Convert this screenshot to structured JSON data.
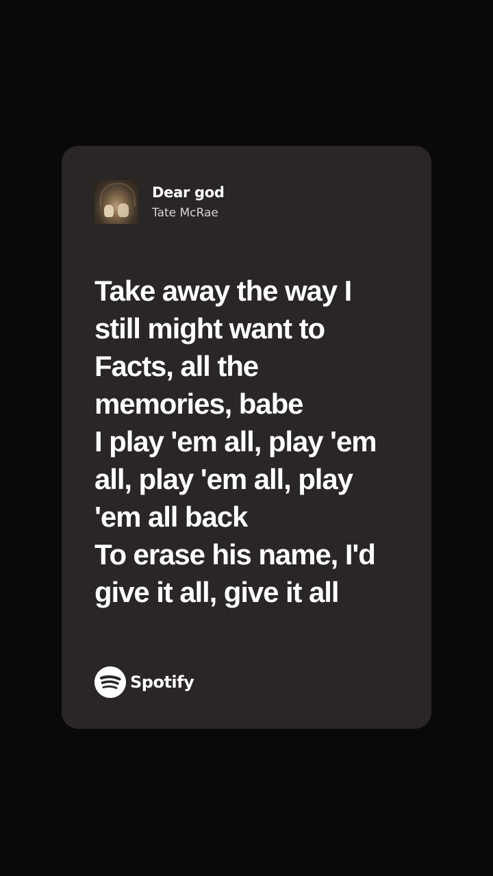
{
  "track": {
    "title": "Dear god",
    "artist": "Tate McRae",
    "album_art_icon": "album-cover-image"
  },
  "lyrics": [
    "Take away the way I",
    "still might want to",
    "Facts, all the",
    "memories, babe",
    "I play 'em all, play 'em",
    "all, play 'em all, play",
    "'em all back",
    "To erase his name, I'd",
    "give it all, give it all"
  ],
  "brand": {
    "name": "Spotify",
    "icon": "spotify-logo-icon"
  },
  "colors": {
    "background": "#0a0909",
    "card": "#2a2626",
    "text": "#ffffff"
  }
}
